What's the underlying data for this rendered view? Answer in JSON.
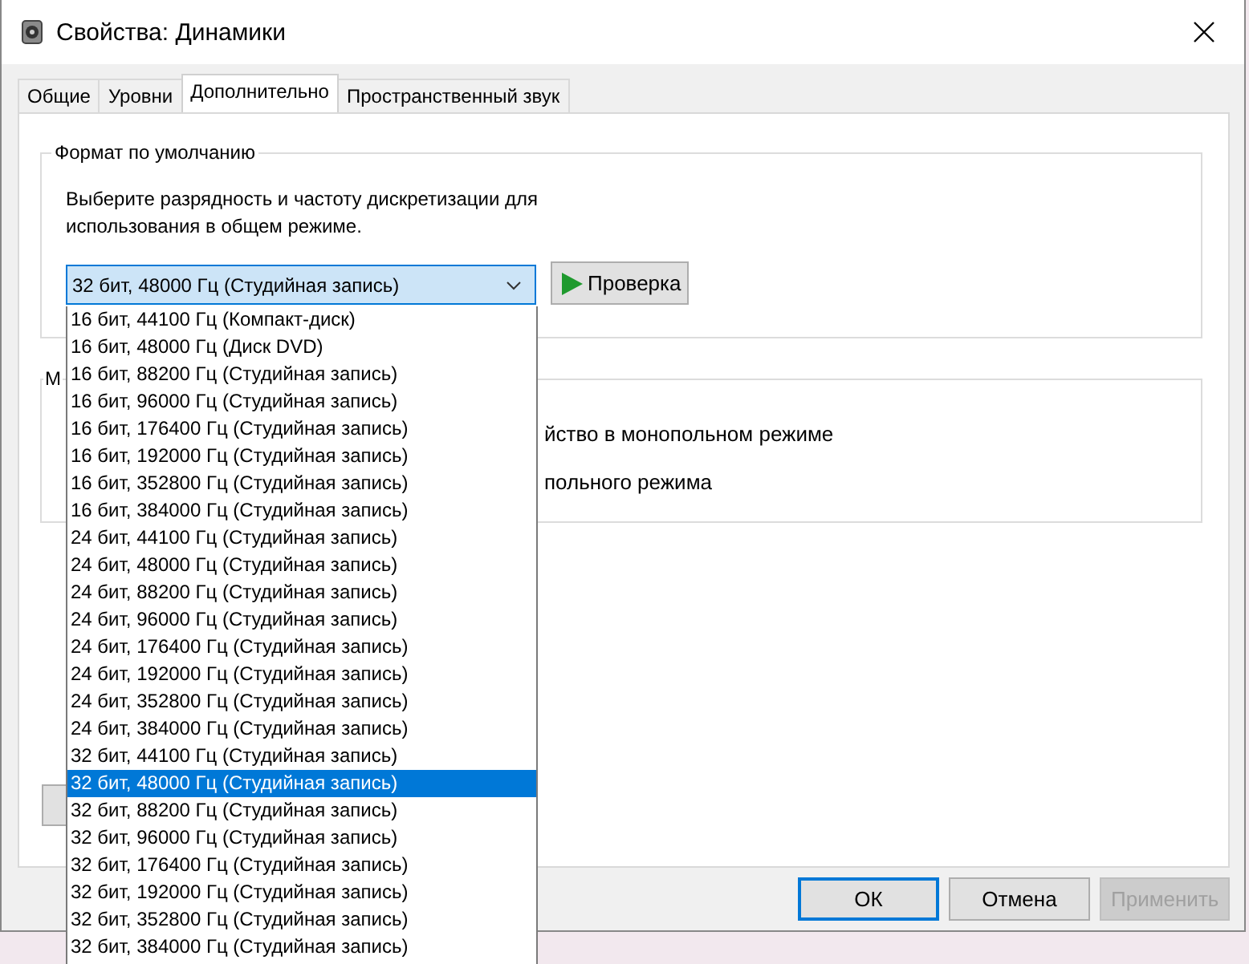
{
  "window": {
    "title": "Свойства: Динамики"
  },
  "tabs": [
    {
      "label": "Общие",
      "selected": false
    },
    {
      "label": "Уровни",
      "selected": false
    },
    {
      "label": "Дополнительно",
      "selected": true
    },
    {
      "label": "Пространственный звук",
      "selected": false
    }
  ],
  "default_format": {
    "title": "Формат по умолчанию",
    "description": "Выберите разрядность и частоту дискретизации для использования в общем режиме.",
    "select_value": "32 бит, 48000 Гц (Студийная запись)",
    "test_button": "Проверка",
    "options": [
      {
        "label": "16 бит, 44100 Гц (Компакт-диск)",
        "selected": false
      },
      {
        "label": "16 бит, 48000 Гц (Диск DVD)",
        "selected": false
      },
      {
        "label": "16 бит, 88200 Гц (Студийная запись)",
        "selected": false
      },
      {
        "label": "16 бит, 96000 Гц (Студийная запись)",
        "selected": false
      },
      {
        "label": "16 бит, 176400 Гц (Студийная запись)",
        "selected": false
      },
      {
        "label": "16 бит, 192000 Гц (Студийная запись)",
        "selected": false
      },
      {
        "label": "16 бит, 352800 Гц (Студийная запись)",
        "selected": false
      },
      {
        "label": "16 бит, 384000 Гц (Студийная запись)",
        "selected": false
      },
      {
        "label": "24 бит, 44100 Гц (Студийная запись)",
        "selected": false
      },
      {
        "label": "24 бит, 48000 Гц (Студийная запись)",
        "selected": false
      },
      {
        "label": "24 бит, 88200 Гц (Студийная запись)",
        "selected": false
      },
      {
        "label": "24 бит, 96000 Гц (Студийная запись)",
        "selected": false
      },
      {
        "label": "24 бит, 176400 Гц (Студийная запись)",
        "selected": false
      },
      {
        "label": "24 бит, 192000 Гц (Студийная запись)",
        "selected": false
      },
      {
        "label": "24 бит, 352800 Гц (Студийная запись)",
        "selected": false
      },
      {
        "label": "24 бит, 384000 Гц (Студийная запись)",
        "selected": false
      },
      {
        "label": "32 бит, 44100 Гц (Студийная запись)",
        "selected": false
      },
      {
        "label": "32 бит, 48000 Гц (Студийная запись)",
        "selected": true
      },
      {
        "label": "32 бит, 88200 Гц (Студийная запись)",
        "selected": false
      },
      {
        "label": "32 бит, 96000 Гц (Студийная запись)",
        "selected": false
      },
      {
        "label": "32 бит, 176400 Гц (Студийная запись)",
        "selected": false
      },
      {
        "label": "32 бит, 192000 Гц (Студийная запись)",
        "selected": false
      },
      {
        "label": "32 бит, 352800 Гц (Студийная запись)",
        "selected": false
      },
      {
        "label": "32 бит, 384000 Гц (Студийная запись)",
        "selected": false
      }
    ]
  },
  "exclusive_group": {
    "title": "М",
    "line_1": "йство в монопольном режиме",
    "line_2": "польного режима"
  },
  "buttons": [
    {
      "label": "ОК",
      "disabled": false,
      "default": true
    },
    {
      "label": "Отмена",
      "disabled": false,
      "default": false
    },
    {
      "label": "Применить",
      "disabled": true,
      "default": false
    }
  ]
}
